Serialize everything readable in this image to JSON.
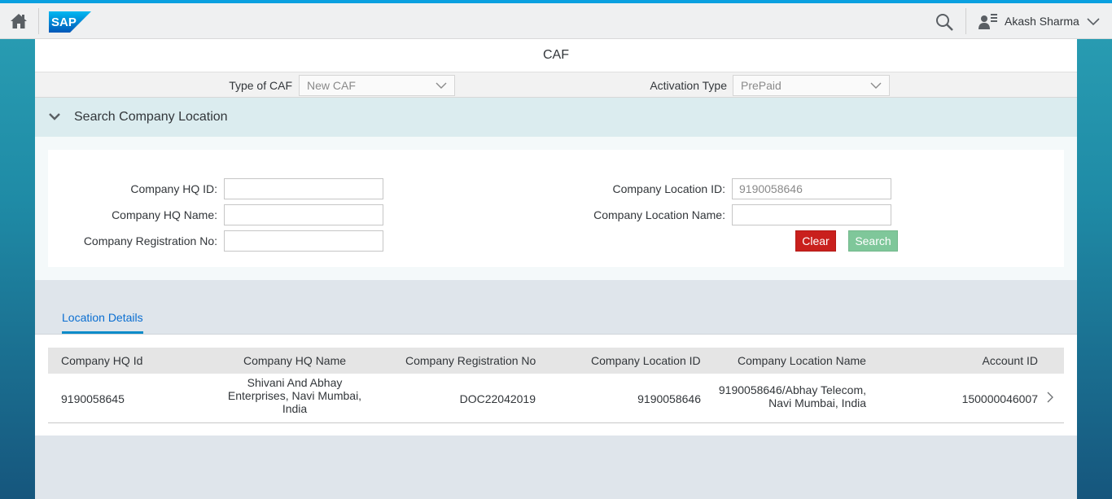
{
  "shell": {
    "user_name": "Akash Sharma",
    "accent": "#0aa0e0"
  },
  "page": {
    "title": "CAF"
  },
  "filters": {
    "type_of_caf_label": "Type of CAF",
    "type_of_caf_value": "New CAF",
    "activation_type_label": "Activation Type",
    "activation_type_value": "PrePaid"
  },
  "search_panel": {
    "title": "Search Company Location",
    "fields": {
      "hq_id_label": "Company HQ ID:",
      "hq_id_value": "",
      "hq_name_label": "Company HQ Name:",
      "hq_name_value": "",
      "reg_no_label": "Company Registration No:",
      "reg_no_value": "",
      "location_id_label": "Company Location ID:",
      "location_id_placeholder": "9190058646",
      "location_name_label": "Company Location Name:",
      "location_name_value": ""
    },
    "clear_label": "Clear",
    "search_label": "Search"
  },
  "tabs": [
    {
      "label": "Location Details",
      "active": true
    }
  ],
  "table": {
    "columns": [
      "Company HQ Id",
      "Company HQ Name",
      "Company Registration No",
      "Company Location ID",
      "Company Location Name",
      "Account ID"
    ],
    "rows": [
      {
        "hq_id": "9190058645",
        "hq_name_line1": "Shivani And Abhay",
        "hq_name_line2": "Enterprises, Navi Mumbai,",
        "hq_name_line3": "India",
        "reg_no": "DOC22042019",
        "location_id": "9190058646",
        "location_name_line1": "9190058646/Abhay Telecom,",
        "location_name_line2": "Navi Mumbai, India",
        "account_id": "150000046007"
      }
    ]
  },
  "colors": {
    "clear_button": "#c9201d",
    "search_button": "#7fc79a",
    "tab_active": "#0a6ed1"
  }
}
